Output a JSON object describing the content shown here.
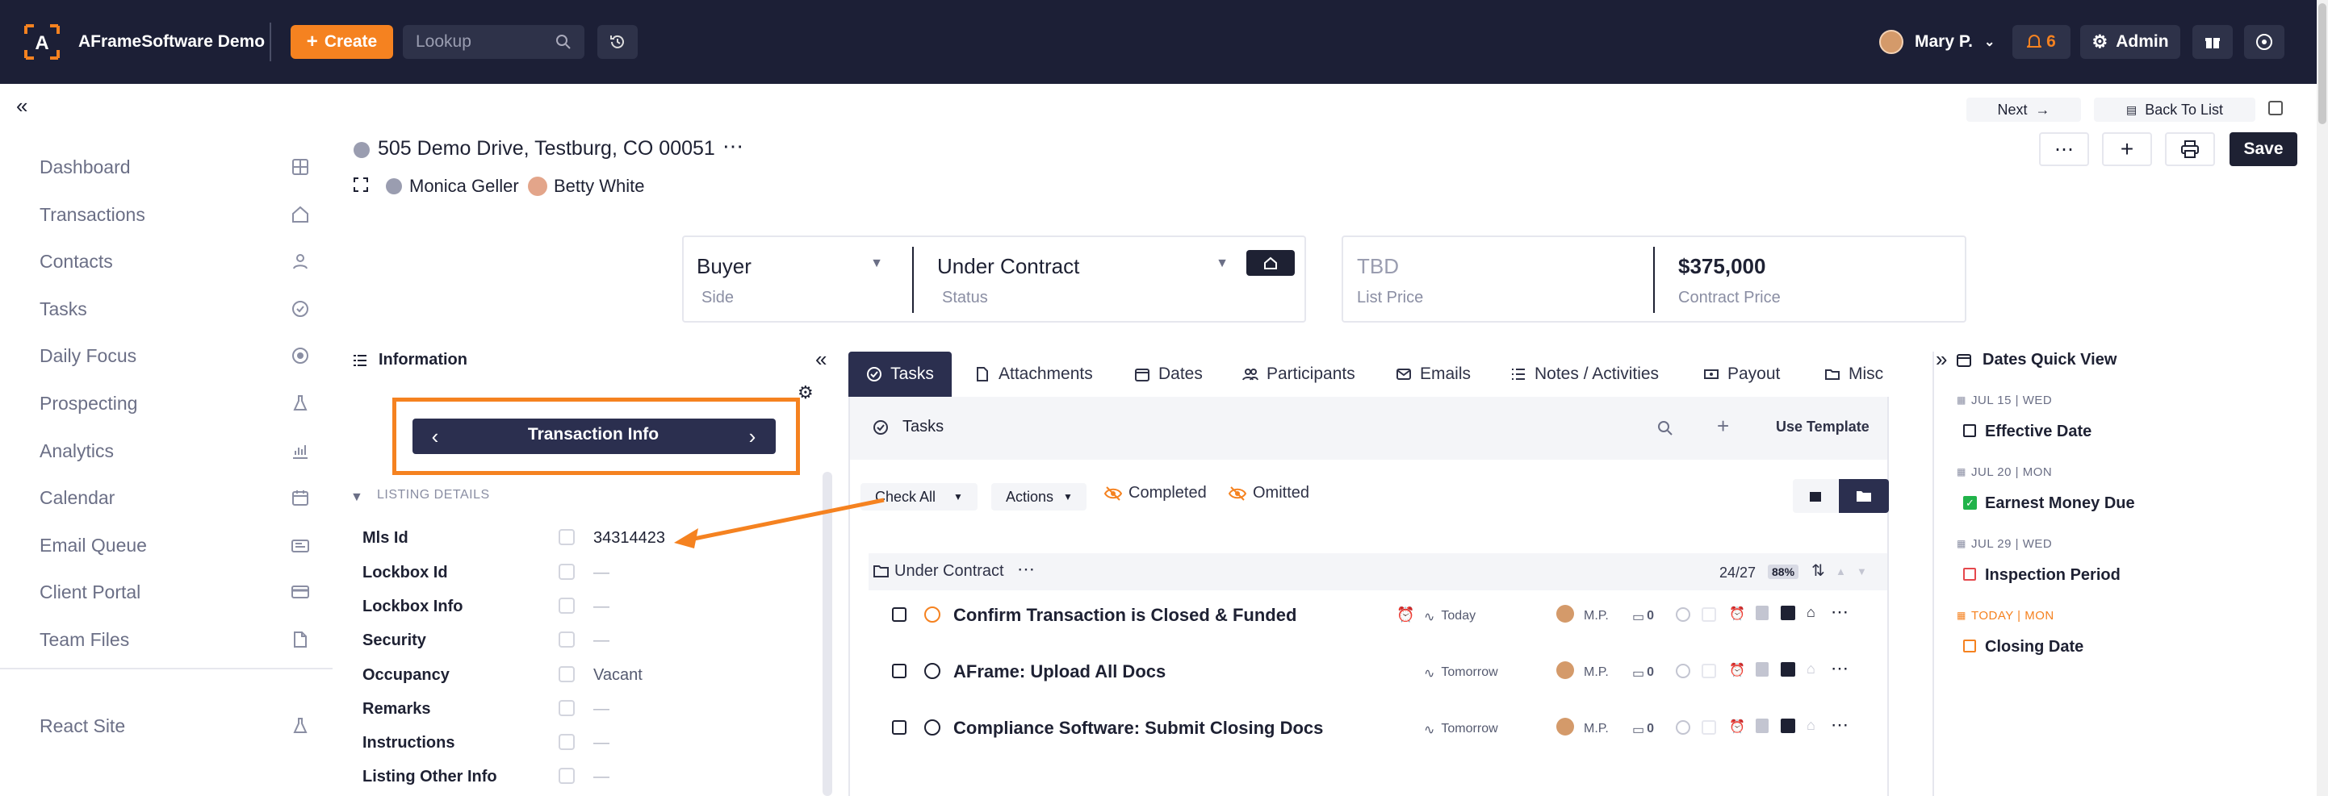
{
  "app": {
    "title": "AFrameSoftware Demo",
    "create_label": "Create",
    "lookup_placeholder": "Lookup",
    "user_name": "Mary P.",
    "notif_count": "6",
    "admin_label": "Admin"
  },
  "sidebar": {
    "items": [
      {
        "label": "Dashboard",
        "icon": "grid-icon"
      },
      {
        "label": "Transactions",
        "icon": "home-icon"
      },
      {
        "label": "Contacts",
        "icon": "person-icon"
      },
      {
        "label": "Tasks",
        "icon": "check-circle-icon"
      },
      {
        "label": "Daily Focus",
        "icon": "target-icon"
      },
      {
        "label": "Prospecting",
        "icon": "flask-icon"
      },
      {
        "label": "Analytics",
        "icon": "chart-icon"
      },
      {
        "label": "Calendar",
        "icon": "calendar-icon"
      },
      {
        "label": "Email Queue",
        "icon": "mail-queue-icon"
      },
      {
        "label": "Client Portal",
        "icon": "card-icon"
      },
      {
        "label": "Team Files",
        "icon": "file-icon"
      }
    ],
    "react_site": "React Site"
  },
  "header": {
    "next_label": "Next",
    "back_label": "Back To List",
    "address": "505 Demo Drive, Testburg, CO 00051",
    "contact1": "Monica Geller",
    "contact2": "Betty White",
    "save_label": "Save"
  },
  "summary": {
    "side_value": "Buyer",
    "side_label": "Side",
    "status_value": "Under Contract",
    "status_label": "Status",
    "list_price_value": "TBD",
    "list_price_label": "List Price",
    "contract_price_value": "$375,000",
    "contract_price_label": "Contract Price"
  },
  "info": {
    "title": "Information",
    "nav_label": "Transaction Info",
    "section": "LISTING DETAILS",
    "fields": [
      {
        "label": "Mls Id",
        "value": "34314423"
      },
      {
        "label": "Lockbox Id",
        "value": "—"
      },
      {
        "label": "Lockbox Info",
        "value": "—"
      },
      {
        "label": "Security",
        "value": "—"
      },
      {
        "label": "Occupancy",
        "value": "Vacant"
      },
      {
        "label": "Remarks",
        "value": "—"
      },
      {
        "label": "Instructions",
        "value": "—"
      },
      {
        "label": "Listing Other Info",
        "value": "—"
      }
    ]
  },
  "tabs": [
    "Tasks",
    "Attachments",
    "Dates",
    "Participants",
    "Emails",
    "Notes / Activities",
    "Payout",
    "Misc"
  ],
  "tasks": {
    "header": "Tasks",
    "use_template": "Use Template",
    "check_all": "Check All",
    "actions": "Actions",
    "completed": "Completed",
    "omitted": "Omitted",
    "group": "Under Contract",
    "count": "24/27",
    "percent": "88%",
    "rows": [
      {
        "title": "Confirm Transaction is Closed & Funded",
        "due": "Today",
        "assignee": "M.P.",
        "comments": "0"
      },
      {
        "title": "AFrame: Upload All Docs",
        "due": "Tomorrow",
        "assignee": "M.P.",
        "comments": "0"
      },
      {
        "title": "Compliance Software: Submit Closing Docs",
        "due": "Tomorrow",
        "assignee": "M.P.",
        "comments": "0"
      }
    ]
  },
  "dates": {
    "title": "Dates Quick View",
    "items": [
      {
        "head": "JUL 15 | WED",
        "title": "Effective Date"
      },
      {
        "head": "JUL 20 | MON",
        "title": "Earnest Money Due"
      },
      {
        "head": "JUL 29 | WED",
        "title": "Inspection Period"
      },
      {
        "head": "TODAY | MON",
        "title": "Closing Date"
      }
    ]
  },
  "colors": {
    "accent": "#f58220",
    "topbar": "#1c1f36",
    "primary": "#2b2f4f",
    "success": "#21b34a",
    "danger": "#e5484d"
  }
}
